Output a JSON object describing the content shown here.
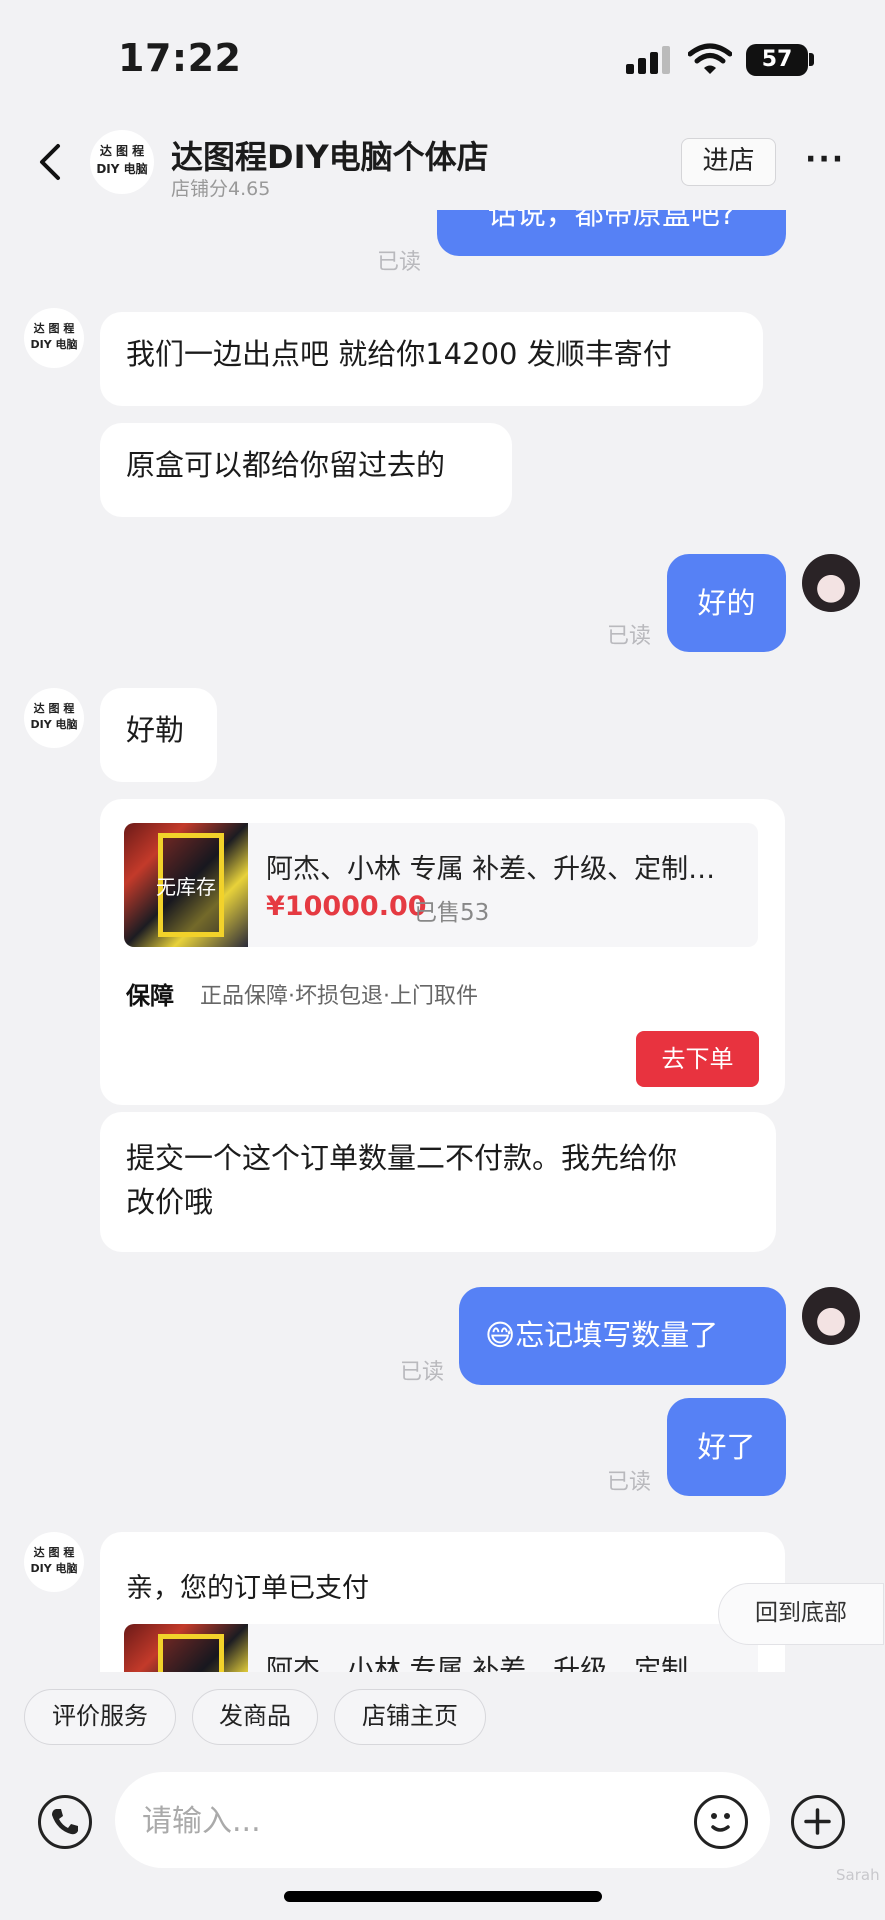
{
  "status_bar": {
    "time": "17:22",
    "battery": "57"
  },
  "header": {
    "shop_avatar_text": [
      "达 图 程",
      "DIY 电脑"
    ],
    "shop_name": "达图程DIY电脑个体店",
    "shop_score": "店铺分4.65",
    "enter_button": "进店"
  },
  "messages": {
    "m1": {
      "text": "话说，都带原盒吧?",
      "read": "已读"
    },
    "m2": {
      "text": "我们一边出点吧  就给你14200 发顺丰寄付"
    },
    "m3": {
      "text": "原盒可以都给你留过去的"
    },
    "m4": {
      "text": "好的",
      "read": "已读"
    },
    "m5": {
      "text": "好勒"
    },
    "product_card": {
      "stock_label": "无库存",
      "title": "阿杰、小林 专属 补差、升级、定制…",
      "price": "¥10000.00",
      "sold": "已售53",
      "guarantee_logo": "保障",
      "guarantee_text": "正品保障·坏损包退·上门取件",
      "order_button": "去下单"
    },
    "m6": {
      "line1": "提交一个这个订单数量二不付款。我先给你",
      "line2": "改价哦"
    },
    "m7": {
      "emoji": "😅",
      "text": "忘记填写数量了",
      "read": "已读"
    },
    "m8": {
      "text": "好了",
      "read": "已读"
    },
    "order_card": {
      "title": "亲，您的订单已支付",
      "product_title": "阿杰、小林 专属 补差、升级、定制…"
    }
  },
  "scroll_to_bottom": "回到底部",
  "quick_actions": [
    "评价服务",
    "发商品",
    "店铺主页"
  ],
  "input": {
    "placeholder": "请输入..."
  },
  "watermark": "Sarah",
  "colors": {
    "outgoing_bubble": "#5681f5",
    "price_red": "#e53a42",
    "order_button": "#e8333f"
  }
}
